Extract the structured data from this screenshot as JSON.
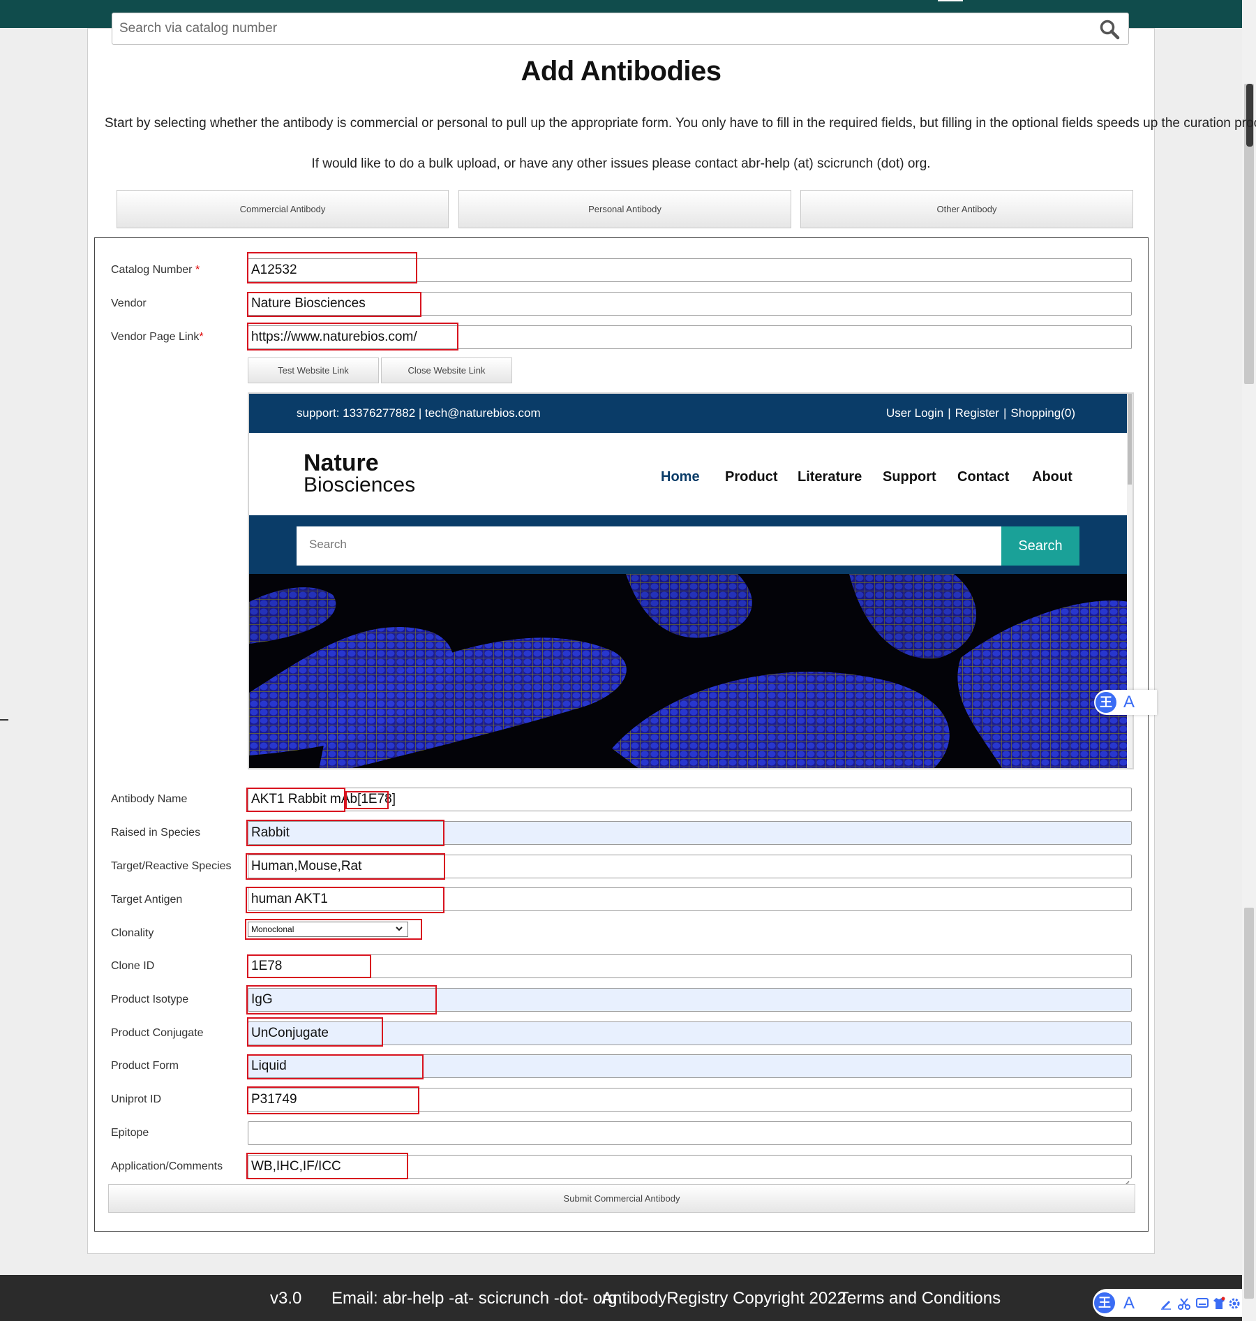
{
  "search": {
    "placeholder": "Search via catalog number"
  },
  "page": {
    "title": "Add Antibodies",
    "intro": "Start by selecting whether the antibody is commercial or personal to pull up the appropriate form. You only have to fill in the required fields, but filling in the optional fields speeds up the curation process.",
    "intro2": "If would like to do a bulk upload, or have any other issues please contact abr-help (at) scicrunch (dot) org."
  },
  "type_buttons": [
    "Commercial Antibody",
    "Personal Antibody",
    "Other Antibody"
  ],
  "form": {
    "catalog_number": {
      "label": "Catalog Number",
      "value": "A12532"
    },
    "vendor": {
      "label": "Vendor",
      "value": "Nature Biosciences"
    },
    "vendor_page_link": {
      "label": "Vendor Page Link",
      "value": "https://www.naturebios.com/"
    },
    "test_link_label": "Test Website Link",
    "close_link_label": "Close Website Link",
    "antibody_name": {
      "label": "Antibody Name",
      "value": "AKT1 Rabbit mAb[1E78]"
    },
    "raised_in_species": {
      "label": "Raised in Species",
      "value": "Rabbit"
    },
    "target_species": {
      "label": "Target/Reactive Species",
      "value": "Human,Mouse,Rat"
    },
    "target_antigen": {
      "label": "Target Antigen",
      "value": "human AKT1"
    },
    "clonality": {
      "label": "Clonality",
      "value": "Monoclonal"
    },
    "clone_id": {
      "label": "Clone ID",
      "value": "1E78"
    },
    "product_isotype": {
      "label": "Product Isotype",
      "value": "IgG"
    },
    "product_conjugate": {
      "label": "Product Conjugate",
      "value": "UnConjugate"
    },
    "product_form": {
      "label": "Product Form",
      "value": "Liquid"
    },
    "uniprot_id": {
      "label": "Uniprot ID",
      "value": "P31749"
    },
    "epitope": {
      "label": "Epitope",
      "value": ""
    },
    "application": {
      "label": "Application/Comments",
      "value": "WB,IHC,IF/ICC"
    },
    "submit_label": "Submit Commercial Antibody"
  },
  "vendor_preview": {
    "support": "support:  13376277882 | tech@naturebios.com",
    "top_links": [
      "User Login",
      "Register",
      "Shopping(0)"
    ],
    "logo_line1": "Nature",
    "logo_line2": "Biosciences",
    "nav": [
      "Home",
      "Product",
      "Literature",
      "Support",
      "Contact",
      "About"
    ],
    "search_placeholder": "Search",
    "search_button": "Search"
  },
  "footer": {
    "version": "v3.0",
    "email": "Email: abr-help -at- scicrunch -dot- org",
    "copyright": "AntibodyRegistry Copyright 2022",
    "terms": "Terms and Conditions"
  },
  "colors": {
    "header_bar": "#104c4c",
    "highlight_box": "#d8131f",
    "vendor_navy": "#0a3c68",
    "vendor_teal": "#1aa198",
    "footer_bg": "#2b2b2b"
  },
  "icons": [
    "search-icon",
    "chevron-down-icon",
    "resize-handle-icon",
    "translate-icon"
  ]
}
